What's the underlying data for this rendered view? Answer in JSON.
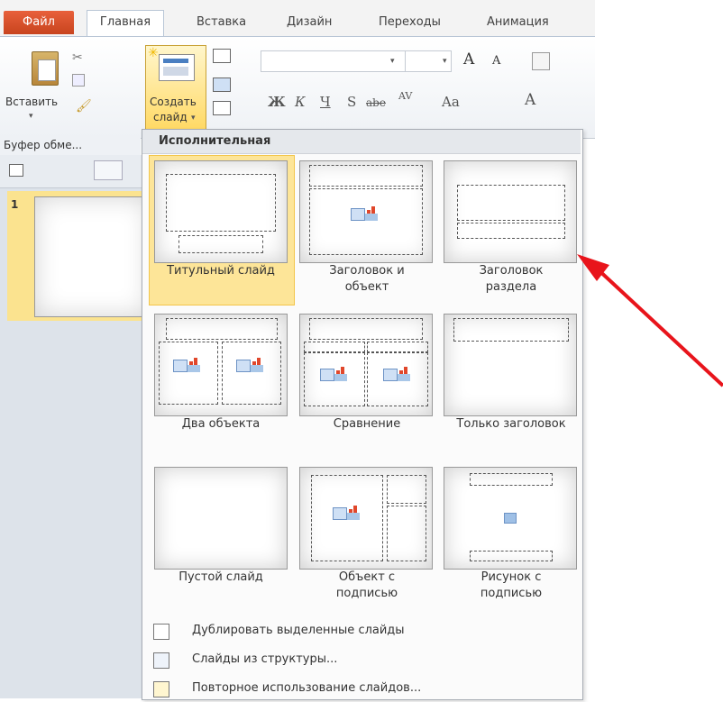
{
  "tabs": [
    {
      "label": "Файл"
    },
    {
      "label": "Главная"
    },
    {
      "label": "Вставка"
    },
    {
      "label": "Дизайн"
    },
    {
      "label": "Переходы"
    },
    {
      "label": "Анимация"
    }
  ],
  "ribbon": {
    "paste_label": "Вставить",
    "new_slide_label_1": "Создать",
    "new_slide_label_2": "слайд",
    "clipboard_group": "Буфер обме...",
    "font_name_value": "",
    "font_size_value": "",
    "bold": "Ж",
    "italic": "К",
    "underline": "Ч",
    "shadow": "S",
    "strike": "abe",
    "spacing": "AV",
    "case": "Aa",
    "grow": "A",
    "shrink": "A",
    "color": "A"
  },
  "left_pane": {
    "slide_number": "1"
  },
  "gallery": {
    "header": "Исполнительная",
    "layouts": [
      {
        "name": "Титульный слайд",
        "selected": true
      },
      {
        "name": "Заголовок и\nобъект"
      },
      {
        "name": "Заголовок\nраздела"
      },
      {
        "name": "Два объекта"
      },
      {
        "name": "Сравнение"
      },
      {
        "name": "Только заголовок"
      },
      {
        "name": "Пустой слайд"
      },
      {
        "name": "Объект с\nподписью"
      },
      {
        "name": "Рисунок с\nподписью"
      }
    ],
    "menu": [
      {
        "label": "Дублировать выделенные слайды"
      },
      {
        "label": "Слайды из структуры..."
      },
      {
        "label": "Повторное использование слайдов..."
      }
    ]
  },
  "colors": {
    "file_tab": "#d9532c",
    "selection": "#fde598",
    "annotation_arrow": "#e8141b"
  }
}
